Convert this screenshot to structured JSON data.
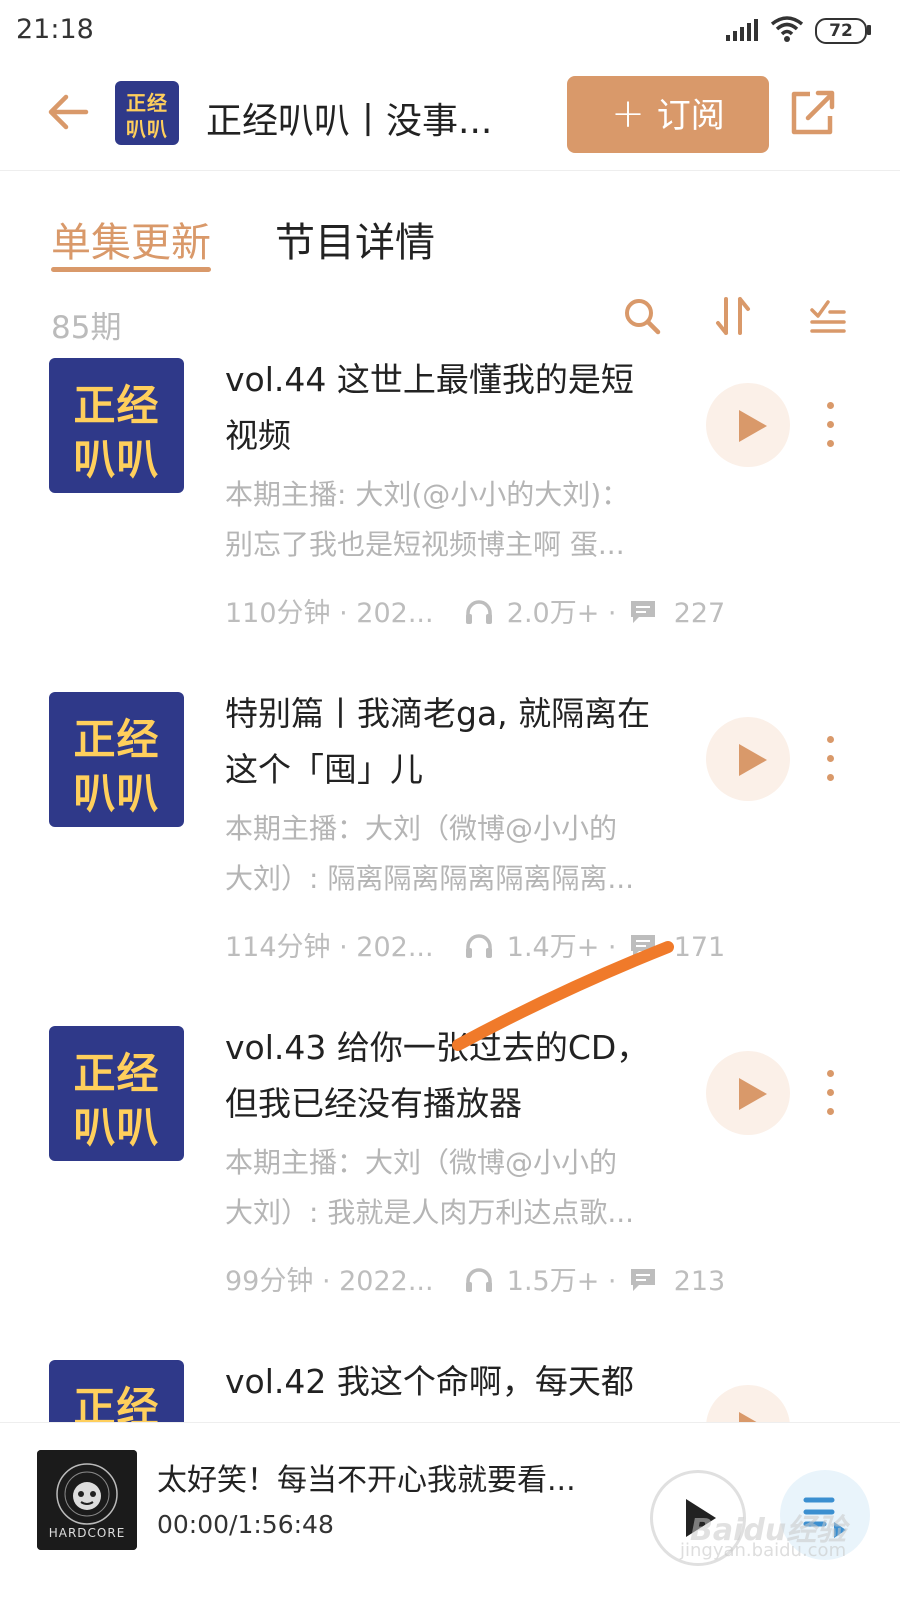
{
  "status_bar": {
    "time": "21:18",
    "battery": "72"
  },
  "header": {
    "title": "正经叭叭丨没事...",
    "subscribe_label": "订阅",
    "logo_line1": "正经",
    "logo_line2": "叭叭"
  },
  "tabs": [
    {
      "label": "单集更新",
      "active": true
    },
    {
      "label": "节目详情",
      "active": false
    }
  ],
  "episode_count": "85期",
  "episodes": [
    {
      "title_line1": "vol.44 这世上最懂我的是短",
      "title_line2": "视频",
      "desc_line1": "本期主播: 大刘(@小小的大刘)：",
      "desc_line2": "别忘了我也是短视频博主啊 蛋...",
      "duration": "110分钟 · 202...",
      "plays": "2.0万+ ·",
      "comments": "227"
    },
    {
      "title_line1": "特别篇丨我滴老ga, 就隔离在",
      "title_line2": "这个「囤」儿",
      "desc_line1": "本期主播：大刘（微博@小小的",
      "desc_line2": "大刘）: 隔离隔离隔离隔离隔离...",
      "duration": "114分钟 · 202...",
      "plays": "1.4万+ ·",
      "comments": "171"
    },
    {
      "title_line1": "vol.43 给你一张过去的CD，",
      "title_line2": "但我已经没有播放器",
      "desc_line1": "本期主播：大刘（微博@小小的",
      "desc_line2": "大刘）: 我就是人肉万利达点歌...",
      "duration": "99分钟 · 2022...",
      "plays": "1.5万+ ·",
      "comments": "213"
    },
    {
      "title_line1": "vol.42 我这个命啊，每天都",
      "title_line2": "",
      "desc_line1": "",
      "desc_line2": "",
      "duration": "",
      "plays": "",
      "comments": ""
    }
  ],
  "mini_player": {
    "title": "太好笑！每当不开心我就要看...",
    "time": "00:00/1:56:48",
    "art_label": "HARDCORE"
  },
  "watermark": {
    "text": "Baidu经验",
    "sub": "jingyan.baidu.com"
  },
  "colors": {
    "accent": "#d9996a",
    "logo_bg": "#2f3989",
    "logo_text": "#ffcf5c"
  },
  "icons": [
    "back-arrow-icon",
    "share-icon",
    "search-icon",
    "sort-icon",
    "filter-list-icon",
    "play-icon",
    "more-vert-icon",
    "headphones-icon",
    "comment-icon",
    "playlist-icon",
    "signal-icon",
    "wifi-icon"
  ]
}
